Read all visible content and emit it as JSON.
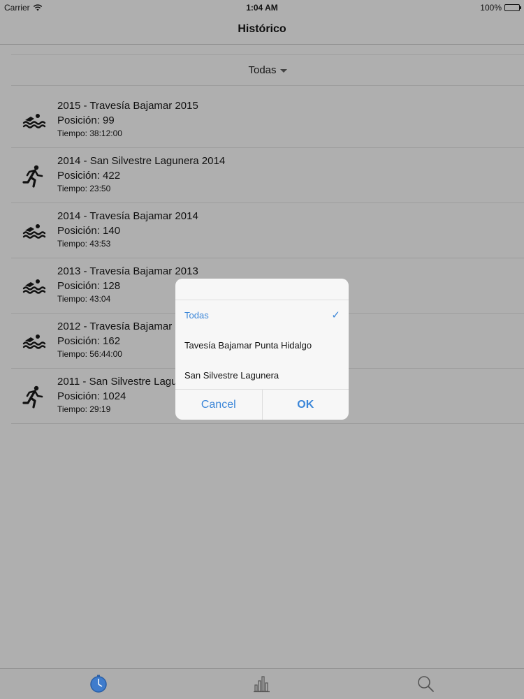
{
  "status_bar": {
    "carrier": "Carrier",
    "time": "1:04 AM",
    "battery": "100%"
  },
  "nav": {
    "title": "Histórico"
  },
  "filter": {
    "label": "Todas"
  },
  "results": [
    {
      "icon": "swimmer-icon",
      "title": "2015 - Travesía Bajamar 2015",
      "position": "Posición: 99",
      "time": "Tiempo: 38:12:00"
    },
    {
      "icon": "runner-icon",
      "title": "2014 - San Silvestre Lagunera 2014",
      "position": "Posición: 422",
      "time": "Tiempo: 23:50"
    },
    {
      "icon": "swimmer-icon",
      "title": "2014 - Travesía Bajamar 2014",
      "position": "Posición: 140",
      "time": "Tiempo: 43:53"
    },
    {
      "icon": "swimmer-icon",
      "title": "2013 - Travesía Bajamar 2013",
      "position": "Posición: 128",
      "time": "Tiempo: 43:04"
    },
    {
      "icon": "swimmer-icon",
      "title": "2012 - Travesía Bajamar 2012",
      "position": "Posición: 162",
      "time": "Tiempo: 56:44:00"
    },
    {
      "icon": "runner-icon",
      "title": "2011 - San Silvestre Lagunera 2011",
      "position": "Posición: 1024",
      "time": "Tiempo: 29:19"
    }
  ],
  "picker": {
    "options": [
      {
        "label": "Todas",
        "selected": true
      },
      {
        "label": "Tavesía Bajamar Punta Hidalgo",
        "selected": false
      },
      {
        "label": "San Silvestre Lagunera",
        "selected": false
      }
    ],
    "cancel_label": "Cancel",
    "ok_label": "OK"
  },
  "tabs": [
    {
      "icon": "stopwatch-icon",
      "active": true
    },
    {
      "icon": "bar-chart-icon",
      "active": false
    },
    {
      "icon": "search-icon",
      "active": false
    }
  ],
  "colors": {
    "accent": "#3b86d8",
    "background": "#afafaf",
    "sheet": "#f7f7f7"
  }
}
